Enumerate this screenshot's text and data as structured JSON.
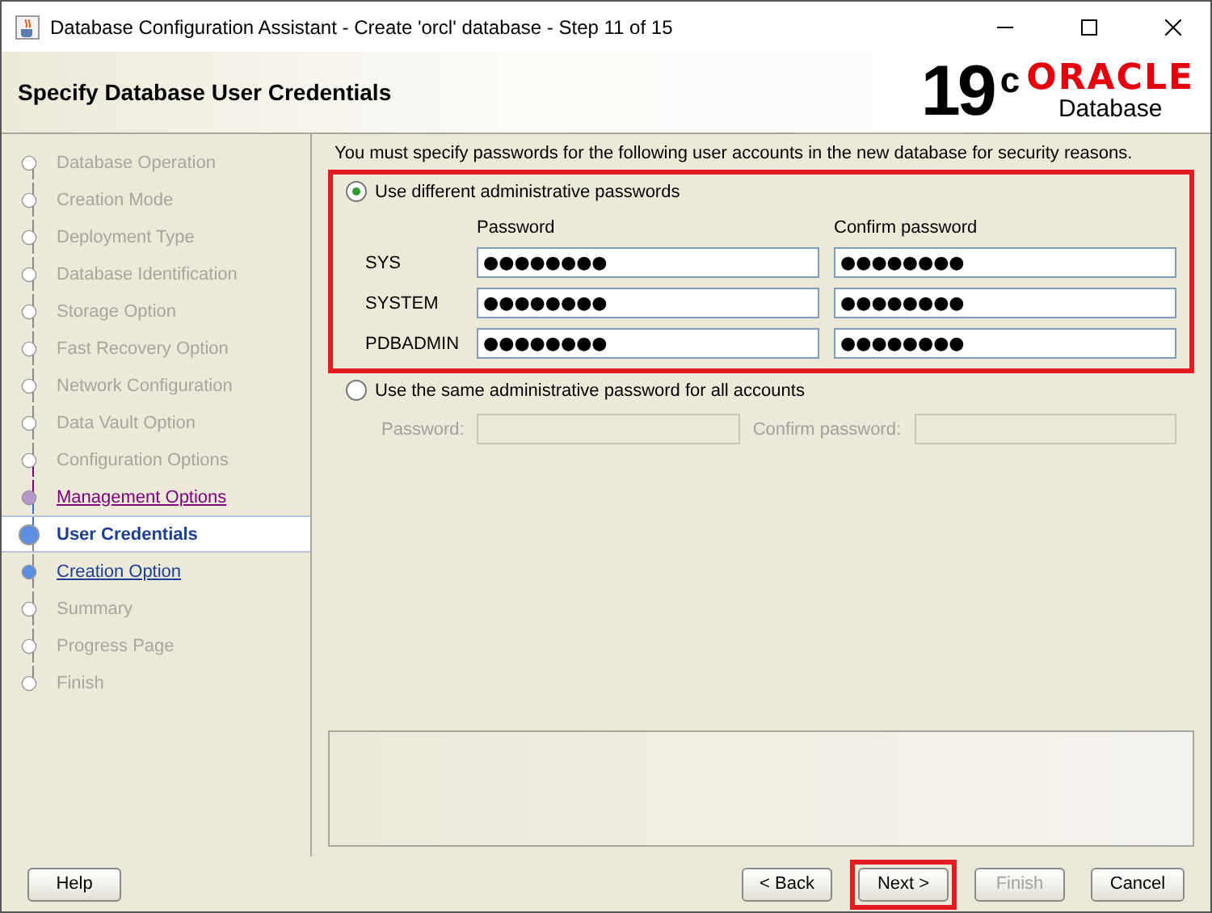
{
  "window": {
    "title": "Database Configuration Assistant - Create 'orcl' database - Step 11 of 15"
  },
  "header": {
    "title": "Specify Database User Credentials",
    "logo": {
      "version": "19",
      "superscript": "c",
      "brand": "ORACLE",
      "product": "Database"
    }
  },
  "steps": [
    {
      "label": "Database Operation",
      "selected": false,
      "link": false
    },
    {
      "label": "Creation Mode",
      "selected": false,
      "link": false
    },
    {
      "label": "Deployment Type",
      "selected": false,
      "link": false
    },
    {
      "label": "Database Identification",
      "selected": false,
      "link": false
    },
    {
      "label": "Storage Option",
      "selected": false,
      "link": false
    },
    {
      "label": "Fast Recovery Option",
      "selected": false,
      "link": false
    },
    {
      "label": "Network Configuration",
      "selected": false,
      "link": false
    },
    {
      "label": "Data Vault Option",
      "selected": false,
      "link": false
    },
    {
      "label": "Configuration Options",
      "selected": false,
      "link": false
    },
    {
      "label": "Management Options",
      "selected": false,
      "link": true,
      "visited": true
    },
    {
      "label": "User Credentials",
      "selected": true,
      "link": false
    },
    {
      "label": "Creation Option",
      "selected": false,
      "link": true,
      "visited": false
    },
    {
      "label": "Summary",
      "selected": false,
      "link": false
    },
    {
      "label": "Progress Page",
      "selected": false,
      "link": false
    },
    {
      "label": "Finish",
      "selected": false,
      "link": false
    }
  ],
  "intro": "You must specify passwords for the following user accounts in the new database for security reasons.",
  "different": {
    "label": "Use different administrative passwords",
    "selected": true,
    "highlighted": true,
    "columns": [
      "Password",
      "Confirm password"
    ],
    "rows": [
      {
        "account": "SYS",
        "password": "●●●●●●●●",
        "confirm": "●●●●●●●●"
      },
      {
        "account": "SYSTEM",
        "password": "●●●●●●●●",
        "confirm": "●●●●●●●●"
      },
      {
        "account": "PDBADMIN",
        "password": "●●●●●●●●",
        "confirm": "●●●●●●●●"
      }
    ]
  },
  "same": {
    "label": "Use the same administrative password for all accounts",
    "selected": false,
    "password_label": "Password:",
    "confirm_label": "Confirm password:"
  },
  "buttons": [
    {
      "label": "Help",
      "disabled": false,
      "highlighted": false
    },
    {
      "label": "< Back",
      "disabled": false,
      "highlighted": false
    },
    {
      "label": "Next >",
      "disabled": false,
      "highlighted": true
    },
    {
      "label": "Finish",
      "disabled": true,
      "highlighted": false
    },
    {
      "label": "Cancel",
      "disabled": false,
      "highlighted": false
    }
  ]
}
